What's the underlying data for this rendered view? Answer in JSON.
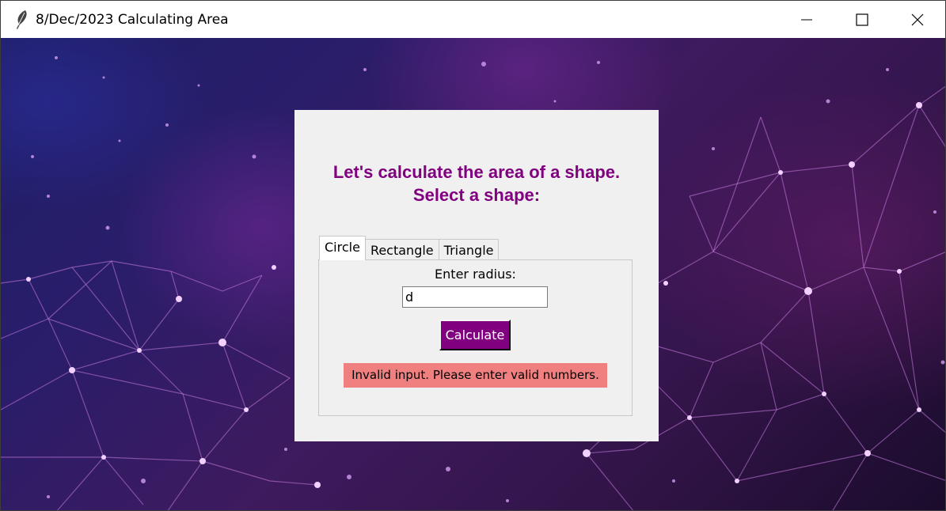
{
  "window": {
    "title": "8/Dec/2023 Calculating Area",
    "app_icon": "feather-icon",
    "controls": [
      "minimize-icon",
      "maximize-icon",
      "close-icon"
    ]
  },
  "heading": {
    "line1": "Let's calculate the area of a shape.",
    "line2": "Select a shape:"
  },
  "tabs": [
    {
      "label": "Circle",
      "active": true
    },
    {
      "label": "Rectangle",
      "active": false
    },
    {
      "label": "Triangle",
      "active": false
    }
  ],
  "circle_form": {
    "label": "Enter radius:",
    "radius_value": "d",
    "calculate_label": "Calculate",
    "error_message": "Invalid input. Please enter valid numbers."
  },
  "colors": {
    "heading": "#800080",
    "button_bg": "#800080",
    "button_text": "#ffffff",
    "error_bg": "#f08080",
    "panel_bg": "#f0f0f0"
  }
}
